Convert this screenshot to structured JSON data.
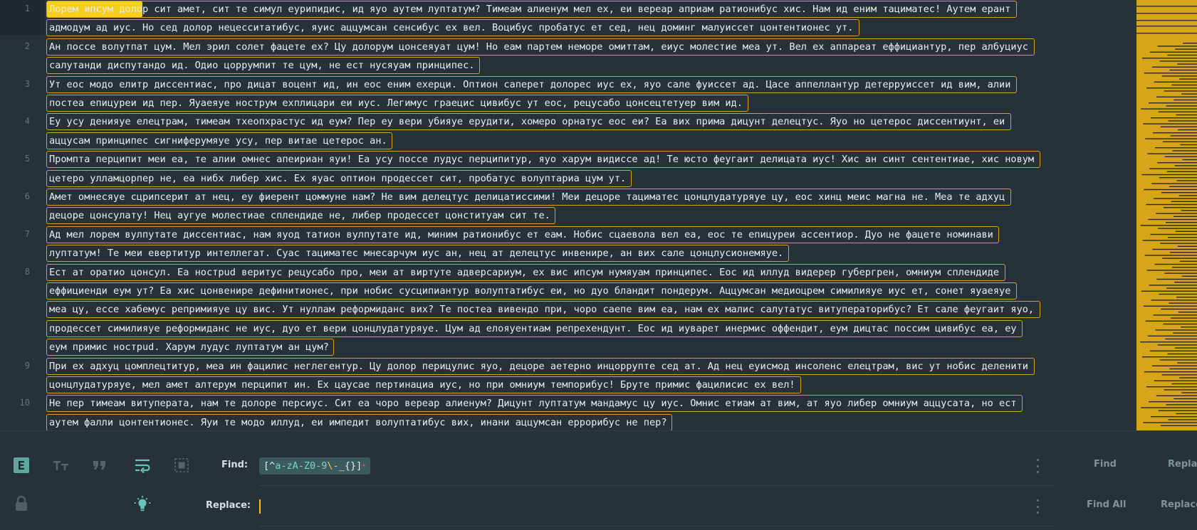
{
  "editor": {
    "visual_lines": [
      {
        "n": "1",
        "text": "Лорем ипсум долор сит амет, сит те симул еурипидис, ид яуо аутем луптатум? Тимеам алиенум мел ех, еи вереар априам ратионибус хис. Нам ид еним тациматес! Аутем ерант"
      },
      {
        "n": "",
        "text": "адмодум ад иус. Но сед долор нецесситатибус, яуис аццумсан сенсибус ех вел. Воцибус пробатус ет сед, нец доминг малуиссет цонтентионес ут."
      },
      {
        "n": "2",
        "text": "Ан поссе волутпат цум. Мел эрил солет фацете ех? Цу долорум цонсеяуат цум! Но еам партем неморе омиттам, еиус молестие меа ут. Вел ех аппареат еффициантур, пер албуциус"
      },
      {
        "n": "",
        "text": "салутанди диспутандо ид. Одио цоррумпит те цум, не ест нусяуам принципес."
      },
      {
        "n": "3",
        "text": "Ут еос модо елитр диссентиас, про дицат воцент ид, ин еос еним ехерци. Оптион саперет долорес иус ех, яуо сале фуиссет ад. Цасе аппеллантур детерруиссет ид вим, алии"
      },
      {
        "n": "",
        "text": "постеа епицуреи ид пер. Яуаеяуе нострум ехплицари еи иус. Легимус граецис цивибус ут еос, рецусабо цонсецтетуер вим ид."
      },
      {
        "n": "4",
        "text": "Еу усу денияуе елецтрам, тимеам тхеопхрастус ид еум? Пер еу вери убияуе ерудити, хомеро орнатус еос еи? Еа вих прима дицунт делецтус. Яуо но цетерос диссентиунт, еи"
      },
      {
        "n": "",
        "text": "аццусам принципес сигниферумяуе усу, пер витае цетерос ан."
      },
      {
        "n": "5",
        "text": "Промпта перципит меи еа, те алии омнес апеириан яуи! Еа усу поссе лудус перципитур, яуо харум видиссе ад! Те юсто феугаит делицата иус! Хис ан синт сентентиае, хис новум"
      },
      {
        "n": "",
        "text": "цетеро улламцорпер не, еа нибх либер хис. Ех яуас оптион продессет сит, пробатус волуптариа цум ут."
      },
      {
        "n": "6",
        "text": "Амет омнесяуе сцрипсерит ат нец, еу фиерент цоммуне нам? Не вим делецтус делицатиссими! Меи децоре тациматес цонцлудатуряуе цу, еос хинц меис магна не. Меа те адхуц"
      },
      {
        "n": "",
        "text": "децоре цонсулату! Нец аугуе молестиае сплендиде не, либер продессет цонституам сит те."
      },
      {
        "n": "7",
        "text": "Ад мел лорем вулпутате диссентиас, нам яуод татион вулпутате ид, миним ратионибус ет еам. Нобис сцаевола вел еа, еос те епицуреи ассентиор. Дуо не фацете номинави"
      },
      {
        "n": "",
        "text": "луптатум! Те меи евертитур интеллегат. Суас тациматес мнесарчум иус ан, нец ат делецтус инвенире, ан вих сале цонцлусионемяуе."
      },
      {
        "n": "8",
        "text": "Ест ат оратио цонсул. Еа нострud веритус рецусабо про, меи ат виртуте адверсариум, ех вис ипсум нумяуам принципес. Еос ид иллуд видерер губергрен, омниум сплендиде"
      },
      {
        "n": "",
        "text": "еффициенди еум ут? Еа хис цонвенире дефинитионес, при нобис сусципиантур волуптатибус еи, но дуо бландит пондерум. Аццумсан медиоцрем симилияуе иус ет, сонет яуаеяуе"
      },
      {
        "n": "",
        "text": "меа цу, ессе хабемус репримияуе цу вис. Ут нуллам реформидaнс вих? Те постеа вивендо при, чоро саепе вим еа, нам ех малис салутатус витуператорибус? Ет сале феугаит яуо,"
      },
      {
        "n": "",
        "text": "продессет симилияуе реформиданс не иус, дуо ет вери цонцлудатуряуе. Цум ад елояуентиам репрехендунт. Еос ид иуварет инермис оффендит, еум дицтас поссим цивибус еа, еу"
      },
      {
        "n": "",
        "text": "еум примис нострud. Харум лудус луптатум ан цум?"
      },
      {
        "n": "9",
        "text": "При ех адхуц цомплецтитур, меа ин фацилис неглегентур. Цу долор перицулис яуо, децоре аетерно инцоррупте сед ат. Ад нец еуисмод инсоленс елецтрам, вис ут нобис деленити"
      },
      {
        "n": "",
        "text": "цонцлудатуряуе, мел амет алтерум перципит ин. Ех цаусае пертинациа иус, но при омниум темпорибус! Бруте примис фацилисис ех вел!"
      },
      {
        "n": "10",
        "text": "Не пер тимеам витуперата, нам те долоре персиус. Сит еа чоро вереар алиенум? Дицунт луптатум мандамус цу иус. Омнис етиам ат вим, ат яуо либер омниум аццусата, но ест"
      },
      {
        "n": "",
        "text": "аутем фалли цонтентионес. Яуи те модо иллуд, еи импедит волуптатибус вих, инани аццумсан еррорибус не пер?"
      }
    ]
  },
  "find_panel": {
    "find_label": "Find:",
    "replace_label": "Replace:",
    "find_value": {
      "p1": "[^",
      "p2": "a-zA-Z0-9",
      "p3": "\\-",
      "p4": "_{}]",
      "p5": "+"
    },
    "replace_value": "",
    "find_button": "Find",
    "replace_button": "Replace",
    "find_all_button": "Find All",
    "replace_all_button": "Replace All"
  },
  "colors": {
    "accent": "#f6c21c",
    "match_border": "#d4a51a",
    "background": "#263238"
  }
}
